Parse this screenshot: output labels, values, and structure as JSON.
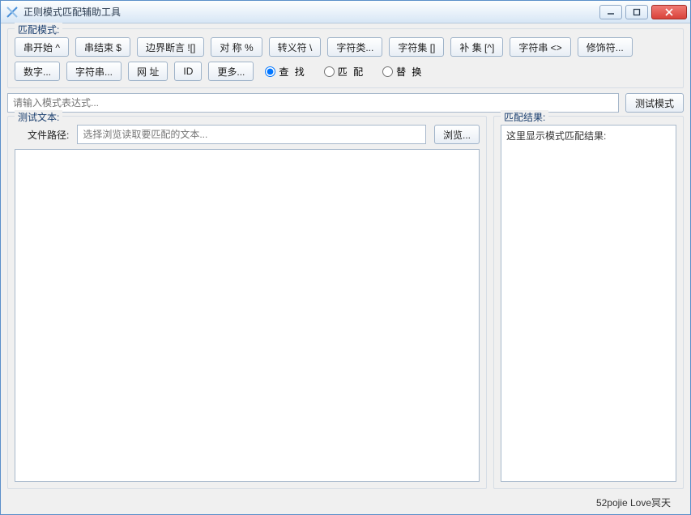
{
  "window": {
    "title": "正则模式匹配辅助工具"
  },
  "match_mode": {
    "legend": "匹配模式:",
    "row1": [
      "串开始 ^",
      "串结束 $",
      "边界断言 ![]",
      "对 称  %",
      "转义符 \\",
      "字符类...",
      "字符集 []",
      "补 集 [^]",
      "字符串 <>",
      "修饰符..."
    ],
    "row2": [
      "数字...",
      "字符串...",
      "网 址",
      "ID",
      "更多..."
    ],
    "radios": {
      "find": "查 找",
      "match": "匹 配",
      "replace": "替 换",
      "selected": "find"
    }
  },
  "pattern": {
    "placeholder": "请输入模式表达式...",
    "value": "",
    "test_btn": "测试模式"
  },
  "test_text": {
    "legend": "测试文本:",
    "file_label": "文件路径:",
    "file_placeholder": "选择浏览读取要匹配的文本...",
    "file_value": "",
    "browse_btn": "浏览...",
    "content": ""
  },
  "result": {
    "legend": "匹配结果:",
    "placeholder": "这里显示模式匹配结果:"
  },
  "footer": "52pojie Love冥天"
}
